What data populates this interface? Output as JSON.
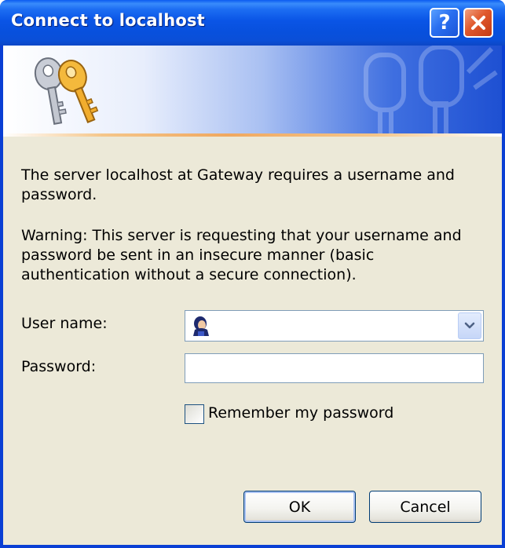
{
  "window": {
    "title": "Connect to localhost",
    "help_label": "?",
    "close_icon": "close-x-icon"
  },
  "banner": {
    "icon": "keys-icon"
  },
  "message": {
    "line1": "The server localhost at Gateway requires a username and password.",
    "line2": "Warning: This server is requesting that your username and password be sent in an insecure manner (basic authentication without a secure connection)."
  },
  "form": {
    "username_label": "User name:",
    "username_value": "",
    "username_icon": "user-icon",
    "password_label": "Password:",
    "password_value": "",
    "remember_label": "Remember my password",
    "remember_checked": false
  },
  "buttons": {
    "ok": "OK",
    "cancel": "Cancel"
  },
  "colors": {
    "titlebar": "#0a55e6",
    "client_bg": "#ece9d8",
    "close_button": "#e0582c",
    "field_border": "#7f9db9"
  }
}
